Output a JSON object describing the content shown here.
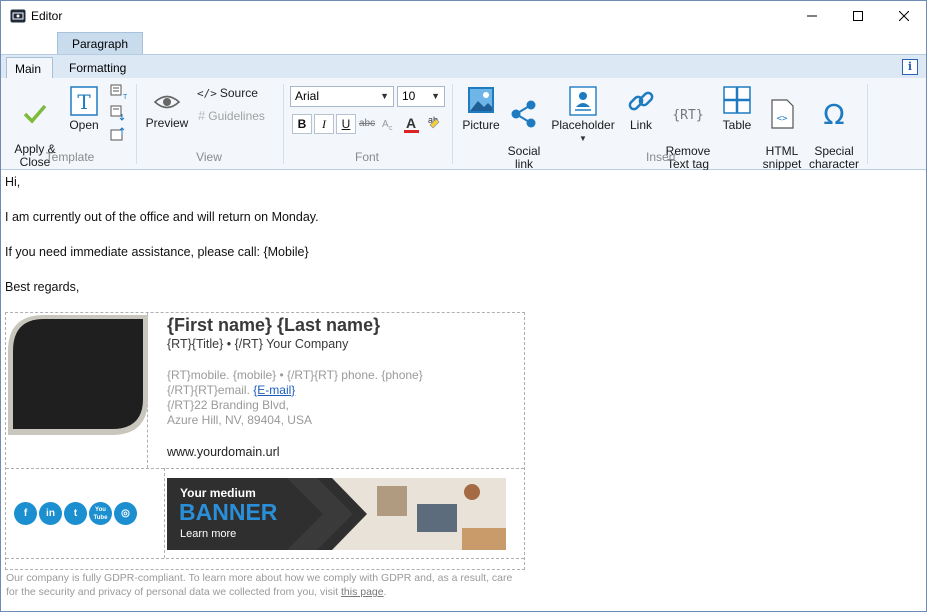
{
  "window": {
    "title": "Editor",
    "icon": "editor-app-icon",
    "controls": [
      "minimize-icon",
      "maximize-icon",
      "close-icon"
    ]
  },
  "ribbon": {
    "contextual_tab": "Paragraph",
    "tabs": [
      {
        "label": "Main",
        "active": true
      },
      {
        "label": "Formatting",
        "active": false
      }
    ],
    "groups": {
      "template": {
        "label": "Template",
        "apply_close": "Apply &\nClose",
        "open": "Open"
      },
      "view": {
        "label": "View",
        "preview": "Preview",
        "source": "Source",
        "guidelines": "Guidelines"
      },
      "font": {
        "label": "Font",
        "family": "Arial",
        "size": "10",
        "bold": "B",
        "italic": "I",
        "underline": "U",
        "strike": "abc"
      },
      "insert": {
        "label": "Insert",
        "picture": "Picture",
        "social_link": "Social\nlink",
        "placeholder": "Placeholder",
        "link": "Link",
        "remove_text_tag": "Remove\nText tag",
        "table": "Table",
        "html_snippet": "HTML\nsnippet",
        "special_character": "Special\ncharacter"
      }
    }
  },
  "content": {
    "greeting": "Hi,",
    "line1": "I am currently out of the office and will return on Monday.",
    "line2": "If you need immediate assistance, please call: {Mobile}",
    "closing": "Best regards,",
    "signature": {
      "name": "{First name} {Last name}",
      "title_line": "{RT}{Title} • {/RT} Your Company",
      "phones": "{RT}mobile. {mobile} • {/RT}{RT} phone. {phone}",
      "email_prefix": "{/RT}{RT}email. ",
      "email": "{E-mail}",
      "address1": "{/RT}22 Branding Blvd,",
      "address2": "Azure Hill, NV, 89404, USA",
      "url": "www.yourdomain.url",
      "social": [
        {
          "name": "facebook-icon",
          "glyph": "f"
        },
        {
          "name": "linkedin-icon",
          "glyph": "in"
        },
        {
          "name": "twitter-icon",
          "glyph": "t"
        },
        {
          "name": "youtube-icon",
          "glyph": "You Tube"
        },
        {
          "name": "instagram-icon",
          "glyph": "◎"
        }
      ],
      "banner": {
        "line1": "Your medium",
        "line2": "BANNER",
        "line3": "Learn more"
      },
      "footer_text": "Our company is fully GDPR-compliant. To learn more about how we comply with GDPR and, as a result, care for the security and privacy of personal data we collected from you, visit ",
      "footer_link": "this page",
      "footer_end": "."
    }
  },
  "colors": {
    "accent": "#1b8fcf",
    "ribbon_bg": "#f3f7fc",
    "tab_bg": "#dde8f5"
  }
}
